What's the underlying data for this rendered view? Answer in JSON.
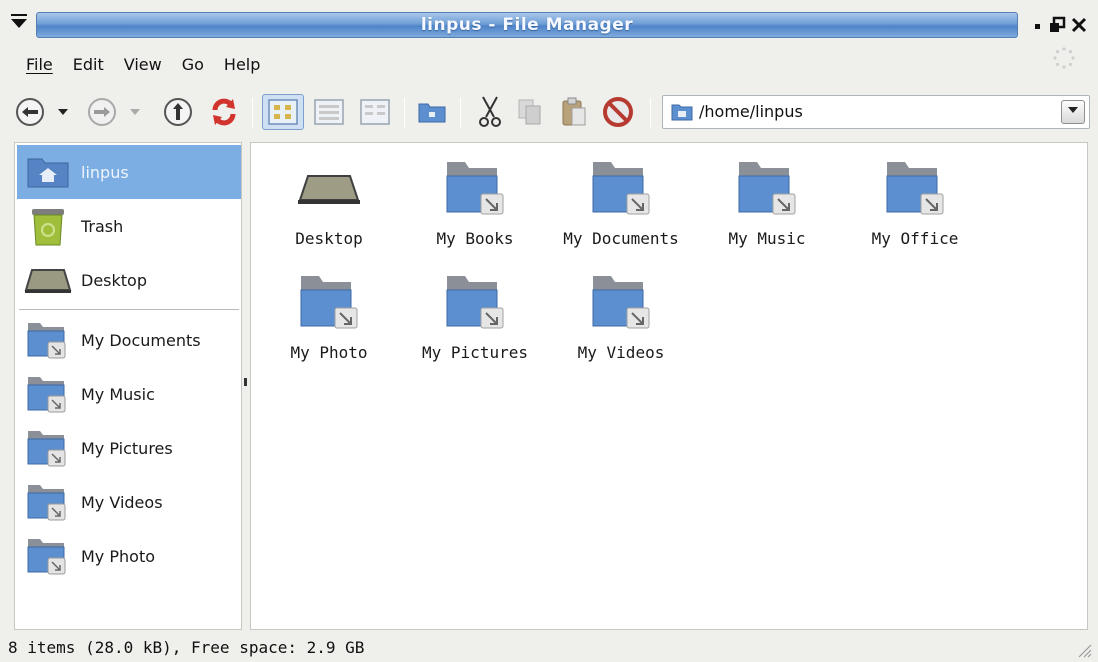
{
  "window": {
    "title": "linpus - File Manager",
    "menu_icon": "window-menu-arrow-icon",
    "controls": [
      "minimize-icon",
      "restore-icon",
      "close-icon"
    ]
  },
  "menubar": {
    "items": [
      {
        "label": "File",
        "mnemonic": "F"
      },
      {
        "label": "Edit",
        "mnemonic": "E"
      },
      {
        "label": "View",
        "mnemonic": "V"
      },
      {
        "label": "Go",
        "mnemonic": "G"
      },
      {
        "label": "Help",
        "mnemonic": "H"
      }
    ]
  },
  "toolbar": {
    "buttons": [
      "back-icon",
      "back-dropdown-icon",
      "forward-icon",
      "forward-dropdown-icon",
      "up-icon",
      "reload-icon",
      "icon-view-icon",
      "detail-view-icon",
      "compact-view-icon",
      "new-folder-icon",
      "cut-icon",
      "copy-icon",
      "paste-icon",
      "delete-icon"
    ],
    "active_view": "icon-view"
  },
  "address": {
    "path": "/home/linpus",
    "icon": "folder-location-icon"
  },
  "sidebar": {
    "places": [
      {
        "label": "linpus",
        "icon": "home-folder-icon",
        "selected": true
      },
      {
        "label": "Trash",
        "icon": "trash-icon",
        "selected": false
      },
      {
        "label": "Desktop",
        "icon": "desktop-icon",
        "selected": false
      }
    ],
    "bookmarks": [
      {
        "label": "My Documents",
        "icon": "folder-link-icon"
      },
      {
        "label": "My Music",
        "icon": "folder-link-icon"
      },
      {
        "label": "My Pictures",
        "icon": "folder-link-icon"
      },
      {
        "label": "My Videos",
        "icon": "folder-link-icon"
      },
      {
        "label": "My Photo",
        "icon": "folder-link-icon"
      }
    ]
  },
  "files": [
    {
      "label": "Desktop",
      "icon": "desktop-icon"
    },
    {
      "label": "My Books",
      "icon": "folder-link-icon"
    },
    {
      "label": "My Documents",
      "icon": "folder-link-icon"
    },
    {
      "label": "My Music",
      "icon": "folder-link-icon"
    },
    {
      "label": "My Office",
      "icon": "folder-link-icon"
    },
    {
      "label": "My Photo",
      "icon": "folder-link-icon"
    },
    {
      "label": "My Pictures",
      "icon": "folder-link-icon"
    },
    {
      "label": "My Videos",
      "icon": "folder-link-icon"
    }
  ],
  "statusbar": {
    "text": "8 items (28.0 kB), Free space: 2.9 GB"
  },
  "colors": {
    "titlebar": "#5b8fd0",
    "selection": "#7daee3",
    "folder": "#5c8fcf"
  }
}
